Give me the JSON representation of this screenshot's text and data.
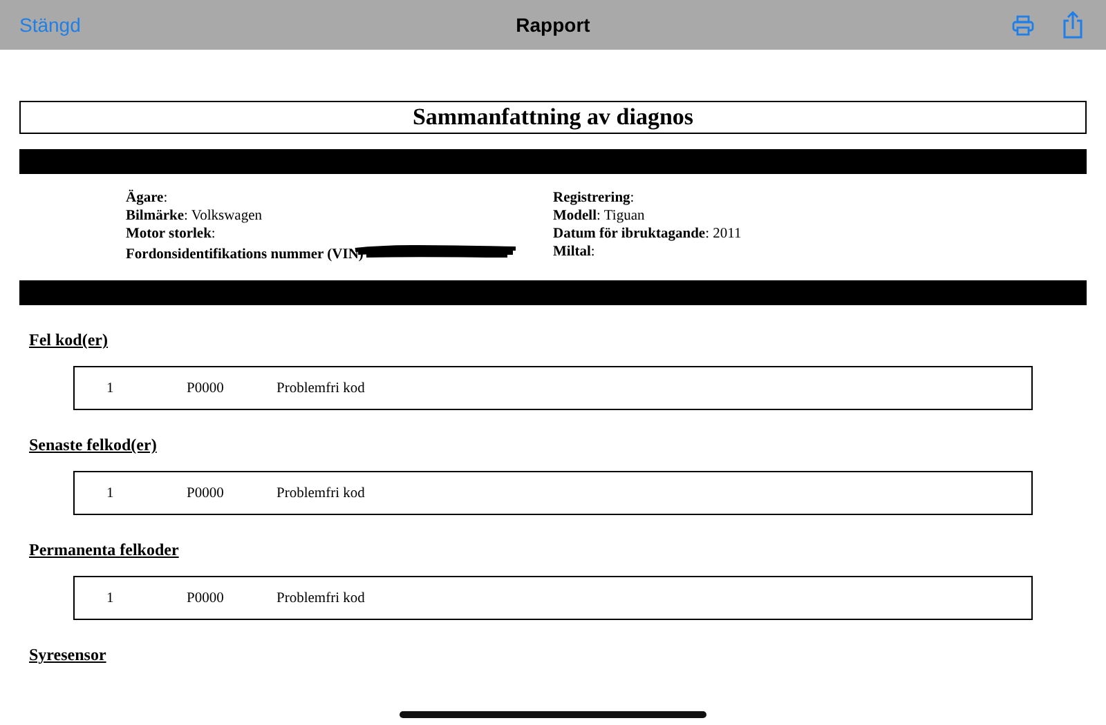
{
  "nav": {
    "close": "Stängd",
    "title": "Rapport"
  },
  "report": {
    "title": "Sammanfattning av diagnos",
    "info_left": [
      {
        "text": "**Ägare**:"
      },
      {
        "text": "**Bilmärke**: Volkswagen"
      },
      {
        "text": "**Motor storlek**:"
      },
      {
        "text": "**Fordonsidentifikations nummer (VIN)**",
        "redacted": true
      }
    ],
    "info_right": [
      {
        "text": "**Registrering**:"
      },
      {
        "text": "**Modell**: Tiguan"
      },
      {
        "text": "**Datum för ibruktagande**: 2011"
      },
      {
        "text": "**Miltal**:"
      }
    ],
    "sections": [
      {
        "heading": "Fel kod(er)",
        "rows": [
          {
            "index": "1",
            "code": "P0000",
            "description": "Problemfri kod"
          }
        ]
      },
      {
        "heading": "Senaste felkod(er)",
        "rows": [
          {
            "index": "1",
            "code": "P0000",
            "description": "Problemfri kod"
          }
        ]
      },
      {
        "heading": "Permanenta felkoder",
        "rows": [
          {
            "index": "1",
            "code": "P0000",
            "description": "Problemfri kod"
          }
        ]
      },
      {
        "heading": "Syresensor"
      }
    ]
  }
}
